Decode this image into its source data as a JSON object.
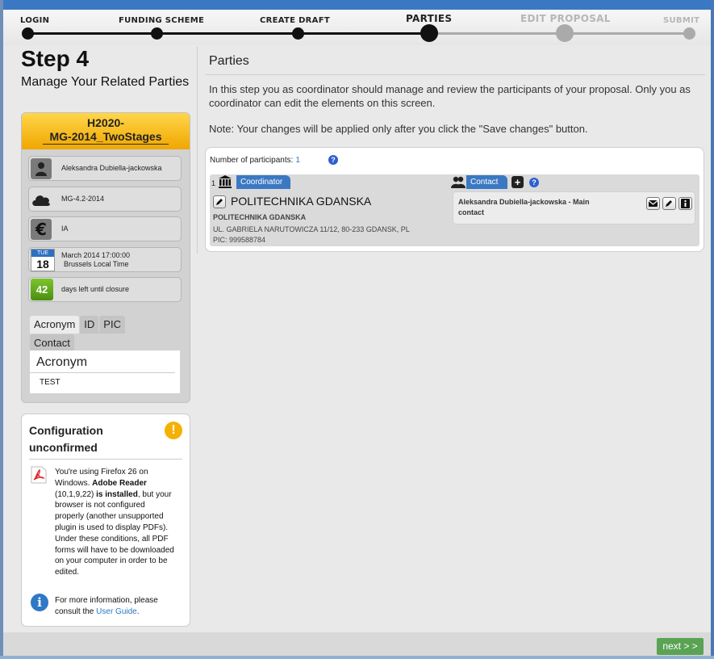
{
  "wizard": {
    "steps": [
      {
        "label": "LOGIN",
        "state": "done"
      },
      {
        "label": "FUNDING SCHEME",
        "state": "done"
      },
      {
        "label": "CREATE DRAFT",
        "state": "done"
      },
      {
        "label": "PARTIES",
        "state": "current"
      },
      {
        "label": "EDIT PROPOSAL",
        "state": "todo"
      },
      {
        "label": "SUBMIT",
        "state": "todo"
      }
    ],
    "colors": {
      "done": "#111111",
      "todo": "#aaaaaa"
    }
  },
  "sidebar": {
    "step_number": "Step 4",
    "step_description": "Manage Your Related Parties",
    "project": {
      "title_line1": "H2020-",
      "title_line2": "MG-2014_TwoStages"
    },
    "info": {
      "user": "Aleksandra Dubiella-jackowska",
      "topic": "MG-4.2-2014",
      "type": "IA",
      "deadline_line1": "March 2014 17:00:00",
      "deadline_line2": "Brussels Local Time",
      "calendar_month": "TUE",
      "calendar_day": "18",
      "days_left": "42",
      "days_left_text": "days left until closure"
    },
    "tabs": [
      "Acronym",
      "ID",
      "PIC",
      "Contact"
    ],
    "active_tab": {
      "title": "Acronym",
      "value": "TEST"
    }
  },
  "config": {
    "title": "Configuration unconfirmed",
    "warn_symbol": "!",
    "message_parts": {
      "p1": "You're using Firefox 26 on Windows. ",
      "b1": "Adobe Reader",
      "p2": " (10,1,9,22) ",
      "b2": "is installed",
      "p3": ", but your browser is not configured properly (another unsupported plugin is used to display PDFs). Under these conditions, all PDF forms will have to be downloaded on your computer in order to be edited."
    },
    "more_prefix": "For more information, please consult the ",
    "more_link": "User Guide",
    "more_suffix": ".",
    "info_symbol": "i"
  },
  "main": {
    "title": "Parties",
    "intro": "In this step you as coordinator should manage and review the participants of your proposal. Only you as coordinator can edit the elements on this screen.",
    "note": "Note: Your changes will be applied only after you click the \"Save changes\" button.",
    "participants_label": "Number of participants:",
    "participants_count": "1",
    "participant": {
      "number": "1",
      "role": "Coordinator",
      "name": "POLITECHNIKA GDANSKA",
      "legal_name": "POLITECHNIKA GDANSKA",
      "address": "UL. GABRIELA NARUTOWICZA 11/12, 80-233 GDANSK, PL",
      "pic": "PIC: 999588784"
    },
    "contact_label": "Contact",
    "contact_name": "Aleksandra Dubiella-jackowska - Main contact",
    "help_symbol": "?",
    "plus_symbol": "+"
  },
  "footer": {
    "next_label": "next > >"
  }
}
